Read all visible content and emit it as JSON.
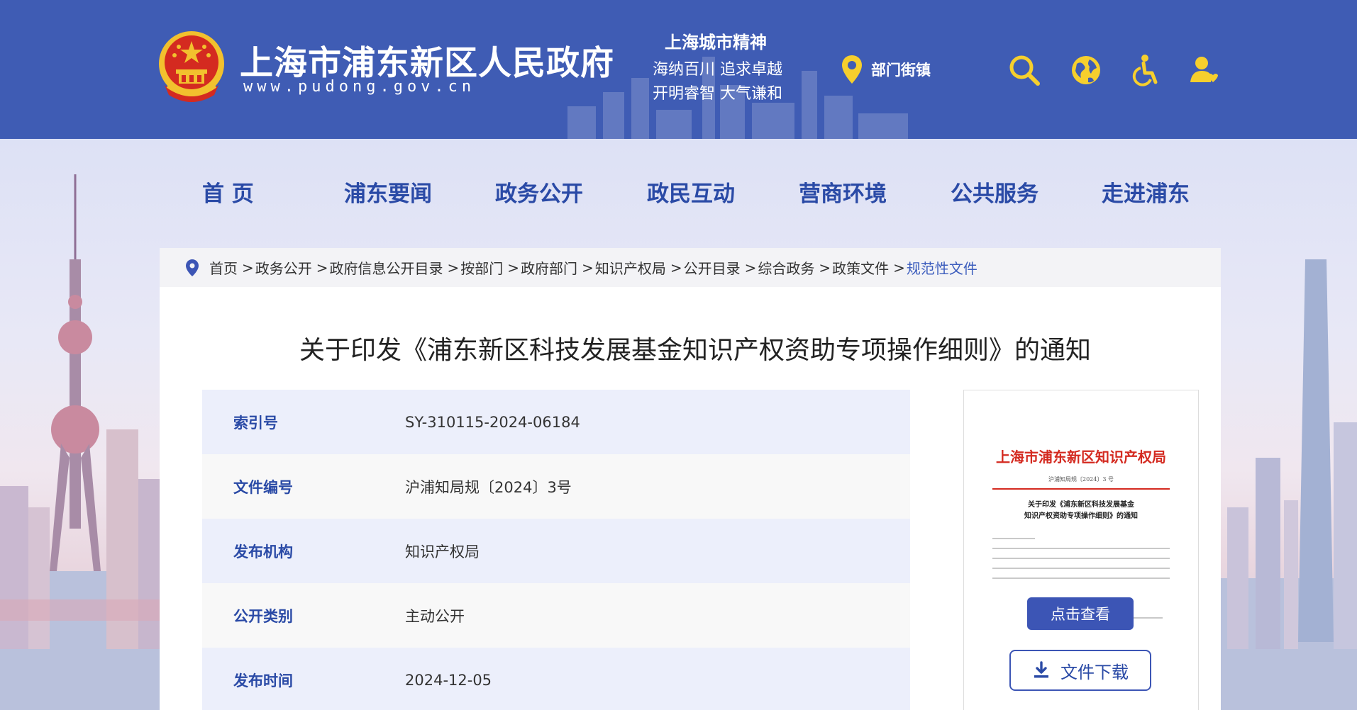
{
  "header": {
    "site_title": "上海市浦东新区人民政府",
    "site_url": "www.pudong.gov.cn",
    "spirit_title": "上海城市精神",
    "spirit_line1": "海纳百川  追求卓越",
    "spirit_line2": "开明睿智  大气谦和",
    "dept_label": "部门街镇",
    "icons": [
      "location-pin-icon",
      "search-icon",
      "globe-icon",
      "accessibility-icon",
      "user-icon"
    ]
  },
  "nav": {
    "items": [
      "首  页",
      "浦东要闻",
      "政务公开",
      "政民互动",
      "营商环境",
      "公共服务",
      "走进浦东"
    ]
  },
  "breadcrumb": {
    "items": [
      "首页",
      "政务公开",
      "政府信息公开目录",
      "按部门",
      "政府部门",
      "知识产权局",
      "公开目录",
      "综合政务",
      "政策文件",
      "规范性文件"
    ],
    "separator": ">"
  },
  "document": {
    "title": "关于印发《浦东新区科技发展基金知识产权资助专项操作细则》的通知",
    "meta": [
      {
        "label": "索引号",
        "value": "SY-310115-2024-06184"
      },
      {
        "label": "文件编号",
        "value": "沪浦知局规〔2024〕3号"
      },
      {
        "label": "发布机构",
        "value": "知识产权局"
      },
      {
        "label": "公开类别",
        "value": "主动公开"
      },
      {
        "label": "发布时间",
        "value": "2024-12-05"
      }
    ]
  },
  "preview": {
    "header": "上海市浦东新区知识产权局",
    "doc_no": "沪浦知局规〔2024〕3 号",
    "title_line1": "关于印发《浦东新区科技发展基金",
    "title_line2": "知识产权资助专项操作细则》的通知",
    "view_button": "点击查看",
    "download_button": "文件下载"
  },
  "colors": {
    "header_bg": "#3f5cb4",
    "nav_text": "#2a4aa6",
    "accent": "#3c55b5",
    "emblem_red": "#d42a20",
    "emblem_gold": "#f2c12e",
    "icon_yellow": "#f6cf2d"
  }
}
